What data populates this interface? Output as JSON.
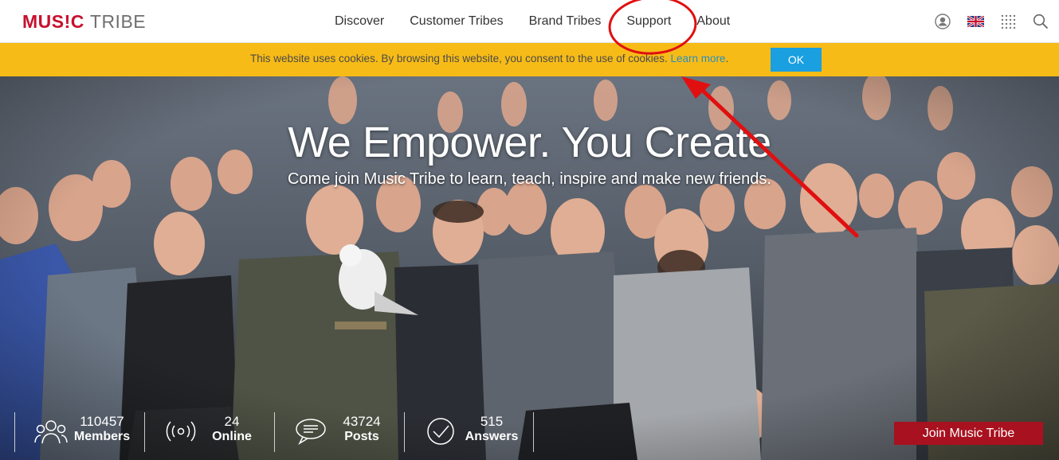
{
  "header": {
    "logo_part1": "MUS!C",
    "logo_part2": "TRIBE",
    "nav": [
      "Discover",
      "Customer Tribes",
      "Brand Tribes",
      "Support",
      "About"
    ],
    "icons": [
      "user-icon",
      "uk-flag-icon",
      "apps-grid-icon",
      "search-icon"
    ]
  },
  "cookie": {
    "text": "This website uses cookies. By browsing this website, you consent to the use of cookies. ",
    "link": "Learn more",
    "ok": "OK"
  },
  "hero": {
    "title": "We Empower. You Create",
    "subtitle": "Come join Music Tribe to learn, teach, inspire and make new friends.",
    "stats": [
      {
        "value": "110457",
        "label": "Members",
        "icon": "members-icon"
      },
      {
        "value": "24",
        "label": "Online",
        "icon": "online-icon"
      },
      {
        "value": "43724",
        "label": "Posts",
        "icon": "posts-icon"
      },
      {
        "value": "515",
        "label": "Answers",
        "icon": "answers-icon"
      }
    ],
    "join": "Join Music Tribe"
  },
  "colors": {
    "brand_red": "#c8102e",
    "cookie_bar": "#f7bb17",
    "ok_button": "#1a9fe0",
    "join_button": "#a8111f",
    "annotation": "#e01010"
  }
}
